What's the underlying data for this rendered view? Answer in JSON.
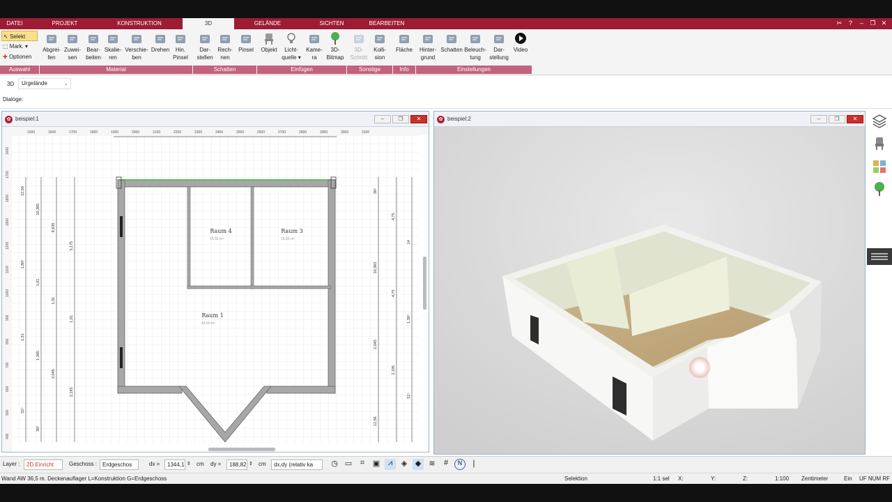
{
  "menu": {
    "tabs": [
      "DATEI",
      "PROJEKT",
      "KONSTRUKTION",
      "3D",
      "GELÄNDE",
      "SICHTEN",
      "BEARBEITEN"
    ],
    "active": "3D"
  },
  "ribbon": {
    "left_options": {
      "select": "Selekt",
      "mark": "Mark.",
      "options": "Optionen"
    },
    "buttons": [
      {
        "label": "Abgrei-\nfen",
        "icon": "eyedropper-icon"
      },
      {
        "label": "Zuwei-\nsen",
        "icon": "assign-brush-icon"
      },
      {
        "label": "Bear-\nbeiten",
        "icon": "edit-brush-icon"
      },
      {
        "label": "Skalie-\nren",
        "icon": "scale-icon"
      },
      {
        "label": "Verschie-\nben",
        "icon": "move-icon"
      },
      {
        "label": "Drehen",
        "icon": "rotate-icon"
      },
      {
        "label": "Hin.\nPinsel",
        "icon": "background-brush-icon"
      },
      {
        "label": "Dar-\nstellen",
        "icon": "shadow-display-icon"
      },
      {
        "label": "Rech-\nnen",
        "icon": "shadow-calc-icon"
      },
      {
        "label": "Pinsel",
        "icon": "shadow-brush-icon"
      },
      {
        "label": "Objekt",
        "icon": "chair-icon"
      },
      {
        "label": "Licht-\nquelle ▾",
        "icon": "lightbulb-icon"
      },
      {
        "label": "Kame-\nra",
        "icon": "camera-icon"
      },
      {
        "label": "3D-\nBitmap",
        "icon": "tree-icon"
      },
      {
        "label": "3D-\nSchnitt",
        "icon": "cut-icon",
        "disabled": true
      },
      {
        "label": "Kolli-\nsion",
        "icon": "collision-icon"
      },
      {
        "label": "Fläche",
        "icon": "area-info-icon"
      },
      {
        "label": "Hinter-\ngrund",
        "icon": "background-icon"
      },
      {
        "label": "Schatten",
        "icon": "shadow-house-icon"
      },
      {
        "label": "Beleuch-\ntung",
        "icon": "lighting-house-icon"
      },
      {
        "label": "Dar-\nstellung",
        "icon": "display-monitor-icon"
      },
      {
        "label": "Video",
        "icon": "play-icon"
      }
    ],
    "groups": [
      "Auswahl",
      "Material",
      "Schatten",
      "Einfügen",
      "Sonstige",
      "Info",
      "Einstellungen"
    ]
  },
  "subbar": {
    "mode": "3D",
    "terrain": "Urgelände",
    "dialogs": "Dialoge:"
  },
  "windows": {
    "plan": {
      "title": "beispiel:1",
      "ruler_top": [
        "1500",
        "1600",
        "1700",
        "1800",
        "1900",
        "2000",
        "2100",
        "2200",
        "2300",
        "2400",
        "2500",
        "2600",
        "2700",
        "2800",
        "2900",
        "3000",
        "3100"
      ],
      "ruler_left": [
        "1600",
        "1700",
        "1800",
        "1900",
        "1200",
        "1100",
        "1000",
        "900",
        "800",
        "700",
        "600",
        "500",
        "400"
      ],
      "rooms": [
        {
          "name": "Raum 4",
          "area": "15,55 m²"
        },
        {
          "name": "Raum 3",
          "area": "16,50 m²"
        },
        {
          "name": "Raum 1",
          "area": "64,50 m²"
        }
      ],
      "dims_left": [
        "12,56",
        "10,365",
        "9,635",
        "5,175",
        "1,80⁵",
        "1,01",
        "1,31",
        "1,01",
        "1,31",
        "1,365",
        "2,045",
        "2,195",
        "51⁵",
        "36⁵"
      ],
      "dims_right": [
        "36⁵",
        "4,75",
        "14",
        "10,365",
        "4,75",
        "1,36⁵",
        "2,045",
        "2,195",
        "51⁵",
        "12,56"
      ]
    },
    "view3d": {
      "title": "beispiel:2"
    }
  },
  "bottombar": {
    "layer_label": "Layer :",
    "layer_value": "2D Einricht",
    "floor_label": "Geschoss :",
    "floor_value": "Erdgeschos",
    "dx_label": "dx =",
    "dx_value": "1344,1",
    "dy_label": "dy =",
    "dy_value": "188,82",
    "unit": "cm",
    "unit2": "cm",
    "mode_value": "dx,dy (relativ ka"
  },
  "statusbar": {
    "message": "Wand AW 36,5 m. Deckenauflager L=Konstruktion G=Erdgeschoss",
    "selektion": "Selektion",
    "scale_sel": "1:1 sel",
    "x": "X:",
    "y": "Y:",
    "z": "Z:",
    "scale": "1:100",
    "unit": "Zentimeter",
    "ein": "Ein",
    "flags": "UF NUM RF"
  },
  "colors": {
    "brand": "#9e1b34",
    "group": "#c2637b",
    "wall": "#a7a7a7",
    "floor": "#c9b38a"
  }
}
